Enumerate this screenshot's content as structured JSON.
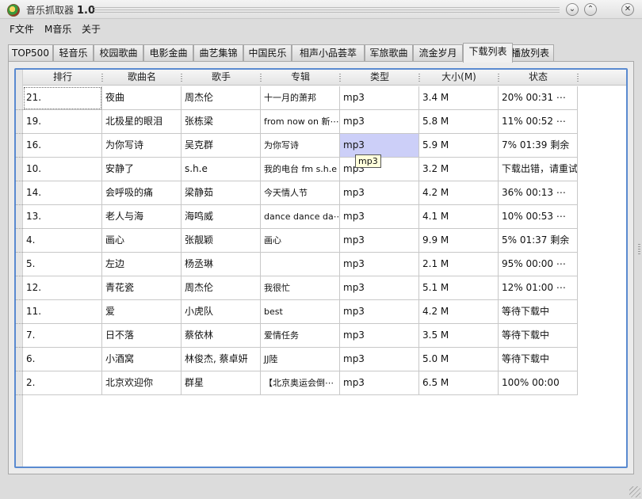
{
  "window": {
    "title": "音乐抓取器",
    "version": "1.0",
    "btn_min": "⌄",
    "btn_max": "⌃",
    "btn_close": "✕"
  },
  "menu": [
    {
      "label": "F文件"
    },
    {
      "label": "M音乐"
    },
    {
      "label": "关于"
    }
  ],
  "tabs": [
    {
      "label": "TOP500"
    },
    {
      "label": "轻音乐"
    },
    {
      "label": "校园歌曲"
    },
    {
      "label": "电影金曲"
    },
    {
      "label": "曲艺集锦"
    },
    {
      "label": "中国民乐"
    },
    {
      "label": "相声小品荟萃"
    },
    {
      "label": "军旅歌曲"
    },
    {
      "label": "流金岁月"
    },
    {
      "label": "下载列表",
      "active": true
    },
    {
      "label": "播放列表"
    }
  ],
  "table": {
    "columns": [
      "排行",
      "歌曲名",
      "歌手",
      "专辑",
      "类型",
      "大小(M)",
      "状态"
    ],
    "rows": [
      [
        "21.",
        "夜曲",
        "周杰伦",
        "十一月的萧邦",
        "mp3",
        "3.4 M",
        "20%    00:31 ⋯"
      ],
      [
        "19.",
        "北极星的眼泪",
        "张栋梁",
        "from now on 新⋯",
        "mp3",
        "5.8 M",
        "11%    00:52 ⋯"
      ],
      [
        "16.",
        "为你写诗",
        "吴克群",
        "为你写诗",
        "mp3",
        "5.9 M",
        "7%    01:39 剩余"
      ],
      [
        "10.",
        "安静了",
        "s.h.e",
        "我的电台 fm s.h.e",
        "mp3",
        "3.2 M",
        "下载出错，请重试!"
      ],
      [
        "14.",
        "会呼吸的痛",
        "梁静茹",
        "今天情人节",
        "mp3",
        "4.2 M",
        "36%    00:13 ⋯"
      ],
      [
        "13.",
        "老人与海",
        "海鸣威",
        "dance dance da⋯",
        "mp3",
        "4.1 M",
        "10%    00:53 ⋯"
      ],
      [
        "4.",
        "画心",
        "张靓颖",
        "画心",
        "mp3",
        "9.9 M",
        "5%    01:37 剩余"
      ],
      [
        "5.",
        "左边",
        "杨丞琳",
        "",
        "mp3",
        "2.1 M",
        "95%    00:00 ⋯"
      ],
      [
        "12.",
        "青花瓷",
        "周杰伦",
        "我很忙",
        "mp3",
        "5.1 M",
        "12%    01:00 ⋯"
      ],
      [
        "11.",
        "爱",
        "小虎队",
        "best",
        "mp3",
        "4.2 M",
        "等待下载中"
      ],
      [
        "7.",
        "日不落",
        "蔡依林",
        "爱情任务",
        "mp3",
        "3.5 M",
        "等待下载中"
      ],
      [
        "6.",
        "小酒窝",
        "林俊杰, 蔡卓妍",
        "JJ陸",
        "mp3",
        "5.0 M",
        "等待下载中"
      ],
      [
        "2.",
        "北京欢迎你",
        "群星",
        "【北京奥运会倒⋯",
        "mp3",
        "6.5 M",
        "100%    00:00"
      ]
    ]
  },
  "tooltip": "mp3"
}
